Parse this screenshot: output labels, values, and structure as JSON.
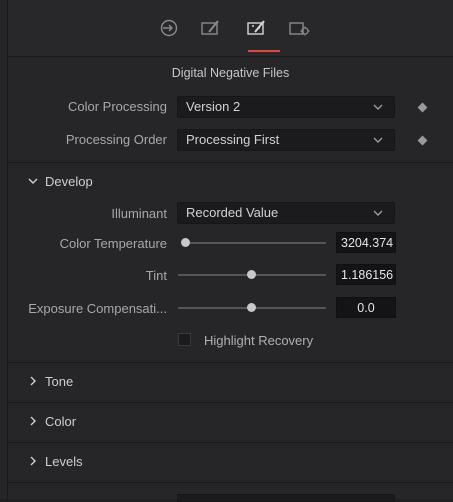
{
  "tabs": [
    {
      "icon": "io-icon"
    },
    {
      "icon": "edit-node-icon"
    },
    {
      "icon": "magic-edit-icon",
      "active": true
    },
    {
      "icon": "settings-node-icon"
    }
  ],
  "header": {
    "title": "Digital Negative Files"
  },
  "fields": {
    "color_processing": {
      "label": "Color Processing",
      "value": "Version 2"
    },
    "processing_order": {
      "label": "Processing Order",
      "value": "Processing First"
    }
  },
  "develop": {
    "title": "Develop",
    "illuminant": {
      "label": "Illuminant",
      "value": "Recorded Value"
    },
    "color_temperature": {
      "label": "Color Temperature",
      "value": "3204.374",
      "level": 0.0
    },
    "tint": {
      "label": "Tint",
      "value": "1.186156",
      "level": 0.5
    },
    "exposure": {
      "label": "Exposure Compensati...",
      "value": "0.0",
      "level": 0.5
    },
    "highlight_recovery": {
      "label": "Highlight Recovery",
      "checked": false
    }
  },
  "sections": [
    {
      "title": "Tone"
    },
    {
      "title": "Color"
    },
    {
      "title": "Levels"
    }
  ],
  "colors": {
    "accent": "#e0463a",
    "panel": "#262629",
    "field": "#1b1b1d"
  }
}
